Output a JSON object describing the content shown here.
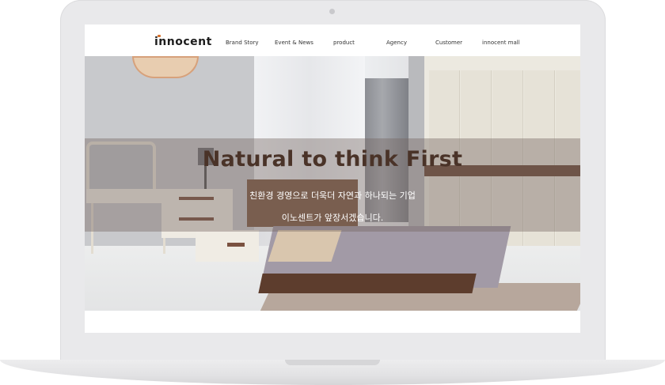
{
  "brand": {
    "logo_text": "innocent",
    "accent_color": "#d8702a"
  },
  "nav": {
    "items": [
      {
        "label": "Brand Story"
      },
      {
        "label": "Event & News"
      },
      {
        "label": "product"
      },
      {
        "label": "Agency"
      },
      {
        "label": "Customer"
      },
      {
        "label": "innocent mall"
      }
    ]
  },
  "hero": {
    "title": "Natural to think First",
    "subtitle_line1": "친환경 경영으로 더욱더 자연과 하나되는 기업",
    "subtitle_line2": "이노센트가 앞장서겠습니다."
  }
}
